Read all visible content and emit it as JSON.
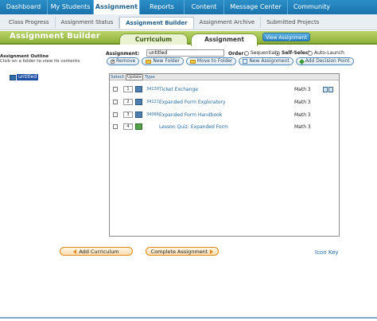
{
  "topnav": {
    "items": [
      "Dashboard",
      "My Students",
      "Assignment",
      "Reports",
      "Content",
      "Message Center",
      "Community"
    ],
    "active_index": 2
  },
  "subnav": {
    "items": [
      "Class Progress",
      "Assignment Status",
      "Assignment Builder",
      "Assignment Archive",
      "Submitted Projects"
    ],
    "active_index": 2
  },
  "header": {
    "page_title": "Assignment Builder",
    "tab_curriculum": "Curriculum",
    "tab_assignment": "Assignment",
    "view_button": "View Assignment"
  },
  "outline": {
    "title": "Assignment Outline",
    "hint": "Click on a folder to view its contents",
    "node_label": "untitled"
  },
  "controls": {
    "assignment_label": "Assignment:",
    "assignment_value": "untitled",
    "order_label": "Order:",
    "order_options": [
      "Sequential",
      "Self-Select",
      "Auto-Launch"
    ],
    "order_selected": "Self-Select",
    "buttons": {
      "remove": "Remove",
      "new_folder": "New Folder",
      "move_to_folder": "Move to Folder",
      "new_assignment": "New Assignment",
      "add_decision_point": "Add Decision Point"
    }
  },
  "grid": {
    "headers": {
      "select": "Select",
      "update": "Update",
      "type": "Type"
    },
    "rows": [
      {
        "order": "1",
        "type_icon": "activity-icon",
        "code": "34130",
        "title": "Ticket Exchange",
        "subject": "Math 3",
        "actions": true
      },
      {
        "order": "2",
        "type_icon": "activity-icon",
        "code": "34121",
        "title": "Expanded Form Exploratory",
        "subject": "Math 3",
        "actions": false
      },
      {
        "order": "3",
        "type_icon": "activity-icon",
        "code": "34066",
        "title": "Expanded Form Handbook",
        "subject": "Math 3",
        "actions": false
      },
      {
        "order": "4",
        "type_icon": "quiz-icon",
        "code": "",
        "title": "Lesson Quiz: Expanded Form",
        "subject": "Math 3",
        "actions": false
      }
    ]
  },
  "footer": {
    "add_curriculum": "Add Curriculum",
    "complete_assignment": "Complete Assignment",
    "icon_key": "Icon Key"
  }
}
